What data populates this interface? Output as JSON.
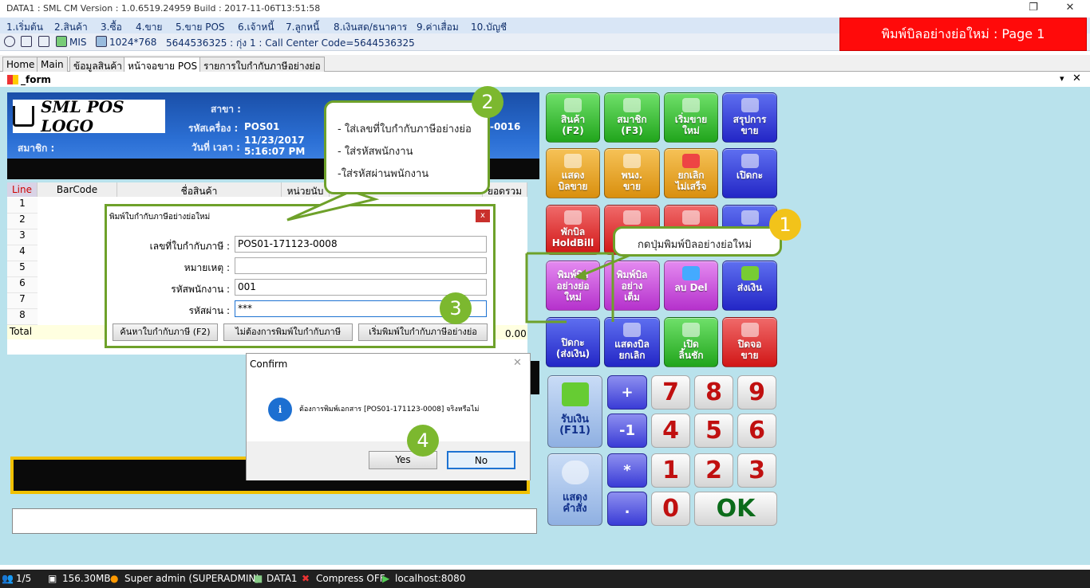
{
  "window": {
    "title": "DATA1 : SML CM Version : 1.0.6519.24959  Build : 2017-11-06T13:51:58",
    "restore": "❐",
    "close": "✕"
  },
  "menu": [
    "1.เริ่มต้น",
    "2.สินค้า",
    "3.ซื้อ",
    "4.ขาย",
    "5.ขาย POS",
    "6.เจ้าหนี้",
    "7.ลูกหนี้",
    "8.เงินสด/ธนาคาร",
    "9.ค่าเสื่อม",
    "10.บัญชี"
  ],
  "toolbar": {
    "mis": "MIS",
    "resolution": "1024*768",
    "info": "5644536325 : กุ่ง 1 : Call Center Code=5644536325"
  },
  "red_banner": "พิมพ์บิลอย่างย่อใหม่ : Page 1",
  "tabs": [
    "Home",
    "Main",
    "ข้อมูลสินค้า",
    "หน้าจอขาย POS",
    "รายการใบกำกับภาษีอย่างย่อ"
  ],
  "form_title": "_form",
  "pos_header": {
    "logo": "SML POS LOGO",
    "branch_label": "สาขา :",
    "machine_label": "รหัสเครื่อง :",
    "machine_value": "POS01",
    "datetime_label": "วันที่ เวลา :",
    "date": "11/23/2017",
    "time": "5:16:07 PM",
    "member_label": "สมาชิก :",
    "doc_suffix": "-0016"
  },
  "grid": {
    "headers": [
      "Line",
      "BarCode",
      "ชื่อสินค้า",
      "หน่วยนับ",
      "ยอดรวม"
    ],
    "rows": [
      "1",
      "2",
      "3",
      "4",
      "5",
      "6",
      "7",
      "8"
    ],
    "total_label": "Total",
    "total_value": "0.00"
  },
  "keys": {
    "product": "สินค้า\n(F2)",
    "member": "สมาชิก\n(F3)",
    "new_sale": "เริ่มขาย\nใหม่",
    "summary": "สรุปการ\nขาย",
    "show_bill": "แสดง\nบิลขาย",
    "staff": "พนง.\nขาย",
    "cancel_unfinished": "ยกเลิก\nไม่เสร็จ",
    "open_shift": "เปิดกะ",
    "hold_bill": "พักบิล\nHoldBill",
    "print_short": "พิมพ์บิล\nอย่างย่อ\nใหม่",
    "print_full": "พิมพ์บิล\nอย่าง\nเต็ม",
    "delete": "ลบ Del",
    "send_money": "ส่งเงิน",
    "close_shift": "ปิดกะ\n(ส่งเงิน)",
    "show_cancelled": "แสดงบิล\nยกเลิก",
    "open_drawer": "เปิด\nลิ้นชัก",
    "close_screen": "ปิดจอ\nขาย",
    "receive": "รับเงิน\n(F11)",
    "show_order": "แสดง\nคำสั่ง",
    "plus": "+",
    "minus1": "-1",
    "star": "*",
    "dot": ".",
    "n7": "7",
    "n8": "8",
    "n9": "9",
    "n4": "4",
    "n5": "5",
    "n6": "6",
    "n1": "1",
    "n2": "2",
    "n3": "3",
    "n0": "0",
    "ok": "OK"
  },
  "dialog": {
    "title": "พิมพ์ใบกำกับภาษีอย่างย่อใหม่",
    "close": "x",
    "fields": [
      {
        "label": "เลขที่ใบกำกับภาษี :",
        "value": "POS01-171123-0008"
      },
      {
        "label": "หมายเหตุ :",
        "value": ""
      },
      {
        "label": "รหัสพนักงาน :",
        "value": "001"
      },
      {
        "label": "รหัสผ่าน :",
        "value": "***"
      }
    ],
    "btn_search": "ค้นหาใบกำกับภาษี (F2)",
    "btn_no_print": "ไม่ต้องการพิมพ์ใบกำกับภาษี",
    "btn_print": "เริ่มพิมพ์ใบกำกับภาษีอย่างย่อ"
  },
  "confirm": {
    "title": "Confirm",
    "message": "ต้องการพิมพ์เอกสาร [POS01-171123-0008] จริงหรือไม่",
    "yes": "Yes",
    "no": "No",
    "close": "✕"
  },
  "callouts": {
    "c1": "กดปุ่มพิมพ์บิลอย่างย่อใหม่",
    "c2_1": "- ใส่เลขที่ใบกำกับภาษีอย่างย่อ",
    "c2_2": "- ใส่รหัสพนักงาน",
    "c2_3": "-ใส่รหัสผ่านพนักงาน"
  },
  "steps": [
    "1",
    "2",
    "3",
    "4"
  ],
  "status": {
    "page": "1/5",
    "memory": "156.30MB",
    "user": "Super admin (SUPERADMIN)",
    "db": "DATA1",
    "compress": "Compress OFF",
    "host": "localhost:8080"
  },
  "colors": {
    "accent_green": "#6ea12a",
    "step_circle": "#7cb82f",
    "banner_red": "#ff0a0a"
  }
}
